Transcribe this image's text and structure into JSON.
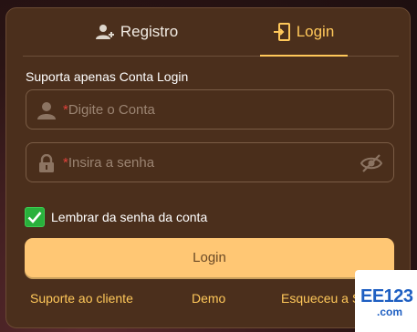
{
  "tabs": {
    "register_label": "Registro",
    "login_label": "Login",
    "active": "login"
  },
  "form": {
    "hint": "Suporta apenas Conta Login",
    "account_placeholder": "Digite o Conta",
    "password_placeholder": "Insira a senha",
    "required_mark": "*",
    "remember_label": "Lembrar da senha da conta",
    "remember_checked": true,
    "submit_label": "Login"
  },
  "links": {
    "support": "Suporte ao cliente",
    "demo": "Demo",
    "forgot": "Esqueceu a Se"
  },
  "badge": {
    "line1": "EE123",
    "line2": ".com"
  },
  "icons": {
    "register_tab": "add-user-icon",
    "login_tab": "login-door-icon",
    "account_field": "user-icon",
    "password_field": "lock-icon",
    "password_toggle": "eye-slash-icon",
    "remember": "check-icon"
  },
  "colors": {
    "accent": "#ffc85a",
    "panel": "#4b2f1c",
    "button": "#ffc774",
    "checkbox": "#29b13c",
    "required": "#e0413b"
  }
}
